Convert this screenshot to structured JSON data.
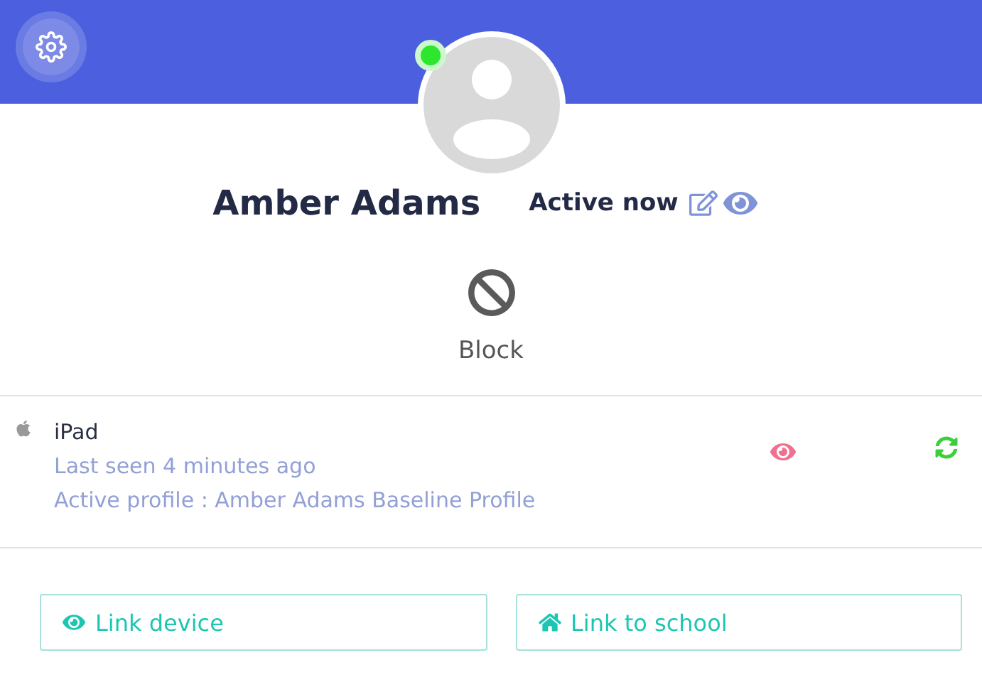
{
  "profile": {
    "name": "Amber Adams",
    "status": "Active now",
    "online": true
  },
  "block": {
    "label": "Block"
  },
  "device": {
    "name": "iPad",
    "last_seen": "Last seen 4 minutes ago",
    "active_profile": "Active profile : Amber Adams Baseline Profile"
  },
  "buttons": [
    {
      "label": "Link device",
      "kind": "eye"
    },
    {
      "label": "Link to school",
      "kind": "home"
    }
  ]
}
